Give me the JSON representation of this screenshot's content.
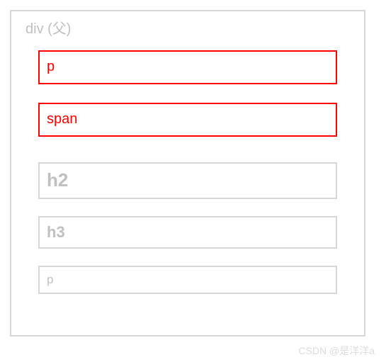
{
  "container": {
    "label": "div (父)"
  },
  "children": [
    {
      "label": "p",
      "highlight": true
    },
    {
      "label": "span",
      "highlight": true
    },
    {
      "label": "h2",
      "highlight": false
    },
    {
      "label": "h3",
      "highlight": false
    },
    {
      "label": "p",
      "highlight": false
    }
  ],
  "watermark": "CSDN @是洋洋a",
  "colors": {
    "highlight_border": "#ff0000",
    "normal_border": "#d6d6d6",
    "normal_text": "#c0c0c0"
  }
}
